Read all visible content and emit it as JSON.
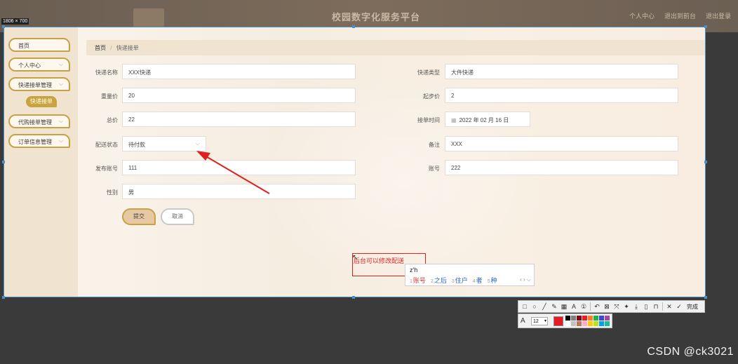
{
  "header": {
    "title": "校园数字化服务平台",
    "links": [
      "个人中心",
      "退出到前台",
      "退出登录"
    ]
  },
  "selection_size": "1806 × 700",
  "sidebar": {
    "items": [
      {
        "label": "首页",
        "chevron": false
      },
      {
        "label": "个人中心",
        "chevron": true
      },
      {
        "label": "快递接单管理",
        "chevron": true
      },
      {
        "label": "代购接单管理",
        "chevron": true
      },
      {
        "label": "订单信息管理",
        "chevron": true
      }
    ],
    "active_sub": "快递接单"
  },
  "breadcrumb": {
    "home": "首页",
    "current": "快递接单"
  },
  "form": {
    "fields_left": [
      {
        "label": "快递名称",
        "value": "XXX快递"
      },
      {
        "label": "重量价",
        "value": "20"
      },
      {
        "label": "总价",
        "value": "22"
      },
      {
        "label": "配送状态",
        "value": "待付款"
      },
      {
        "label": "发布账号",
        "value": "111"
      },
      {
        "label": "性别",
        "value": "男"
      }
    ],
    "fields_right": [
      {
        "label": "快递类型",
        "value": "大件快递"
      },
      {
        "label": "起步价",
        "value": "2"
      },
      {
        "label": "接单时间",
        "value": "2022 年 02 月 16 日"
      },
      {
        "label": "备注",
        "value": "XXX"
      },
      {
        "label": "账号",
        "value": "222"
      }
    ],
    "submit_label": "提交",
    "cancel_label": "取消"
  },
  "annotation": {
    "text": "后台可以修改配送",
    "color": "#e02020"
  },
  "ime": {
    "input": "z'h",
    "candidates": [
      {
        "n": "1",
        "text": "账号"
      },
      {
        "n": "2",
        "text": "之后"
      },
      {
        "n": "3",
        "text": "住户"
      },
      {
        "n": "4",
        "text": "者"
      },
      {
        "n": "5",
        "text": "种"
      }
    ]
  },
  "toolbar": {
    "done_label": "完成"
  },
  "palette": {
    "font_size": "12",
    "current_color": "#e51c23"
  },
  "watermark": "CSDN @ck3021",
  "colors": {
    "accent": "#c7a244",
    "sidebar_bg": "#f0e3cf",
    "selection_border": "#4a90c8"
  }
}
